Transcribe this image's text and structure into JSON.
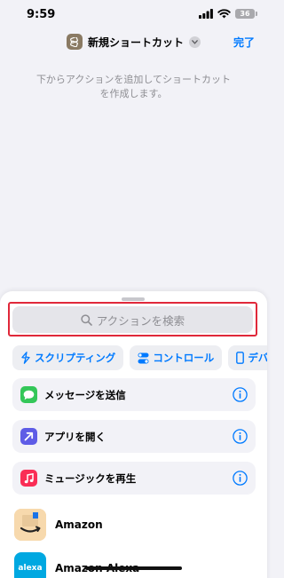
{
  "status_bar": {
    "time": "9:59",
    "battery": "36"
  },
  "nav": {
    "title": "新規ショートカット",
    "done_label": "完了"
  },
  "hint": {
    "line1": "下からアクションを追加してショートカット",
    "line2": "を作成します。"
  },
  "search": {
    "placeholder": "アクションを検索"
  },
  "chips": [
    {
      "label": "スクリプティング",
      "icon": "scripting-icon"
    },
    {
      "label": "コントロール",
      "icon": "control-icon"
    },
    {
      "label": "デバ",
      "icon": "device-icon"
    }
  ],
  "suggestions": [
    {
      "label": "メッセージを送信",
      "icon": "messages-icon",
      "color": "#34c759"
    },
    {
      "label": "アプリを開く",
      "icon": "open-app-icon",
      "color": "#5e5ce6"
    },
    {
      "label": "ミュージックを再生",
      "icon": "music-icon",
      "color": "#ff2d55"
    }
  ],
  "apps": [
    {
      "label": "Amazon",
      "icon": "amazon-icon",
      "color": "#f7d9ad"
    },
    {
      "label": "Amazon Alexa",
      "icon": "alexa-icon",
      "color": "#00a8e1",
      "badge": "alexa"
    }
  ]
}
